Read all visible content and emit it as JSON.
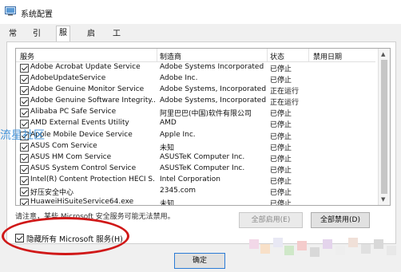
{
  "window": {
    "title": "系统配置"
  },
  "tabs": [
    "常规",
    "引导",
    "服务",
    "启动",
    "工具"
  ],
  "columns": {
    "service": "服务",
    "manufacturer": "制造商",
    "status": "状态",
    "disabled_date": "禁用日期"
  },
  "services": [
    {
      "name": "Adobe Acrobat Update Service",
      "manufacturer": "Adobe Systems Incorporated",
      "status": "已停止",
      "date": ""
    },
    {
      "name": "AdobeUpdateService",
      "manufacturer": "Adobe Inc.",
      "status": "已停止",
      "date": ""
    },
    {
      "name": "Adobe Genuine Monitor Service",
      "manufacturer": "Adobe Systems, Incorporated",
      "status": "正在运行",
      "date": ""
    },
    {
      "name": "Adobe Genuine Software Integrity...",
      "manufacturer": "Adobe Systems, Incorporated",
      "status": "正在运行",
      "date": ""
    },
    {
      "name": "Alibaba PC Safe Service",
      "manufacturer": "阿里巴巴(中国)软件有限公司",
      "status": "已停止",
      "date": ""
    },
    {
      "name": "AMD External Events Utility",
      "manufacturer": "AMD",
      "status": "已停止",
      "date": ""
    },
    {
      "name": "Apple Mobile Device Service",
      "manufacturer": "Apple Inc.",
      "status": "已停止",
      "date": ""
    },
    {
      "name": "ASUS Com Service",
      "manufacturer": "未知",
      "status": "已停止",
      "date": ""
    },
    {
      "name": "ASUS HM Com Service",
      "manufacturer": "ASUSTeK Computer Inc.",
      "status": "已停止",
      "date": ""
    },
    {
      "name": "ASUS System Control Service",
      "manufacturer": "ASUSTeK Computer Inc.",
      "status": "已停止",
      "date": ""
    },
    {
      "name": "Intel(R) Content Protection HECI S...",
      "manufacturer": "Intel Corporation",
      "status": "已停止",
      "date": ""
    },
    {
      "name": "好压安全中心",
      "manufacturer": "2345.com",
      "status": "已停止",
      "date": ""
    },
    {
      "name": "HuaweiHiSuiteService64.exe",
      "manufacturer": "未知",
      "status": "已停止",
      "date": ""
    }
  ],
  "note": "请注意，某些 Microsoft 安全服务可能无法禁用。",
  "buttons": {
    "enable_all": "全部启用(E)",
    "disable_all": "全部禁用(D)",
    "ok": "确定"
  },
  "hide_ms": {
    "label": "隐藏所有 Microsoft 服务(H)",
    "checked": true
  },
  "watermark": "流星社区"
}
